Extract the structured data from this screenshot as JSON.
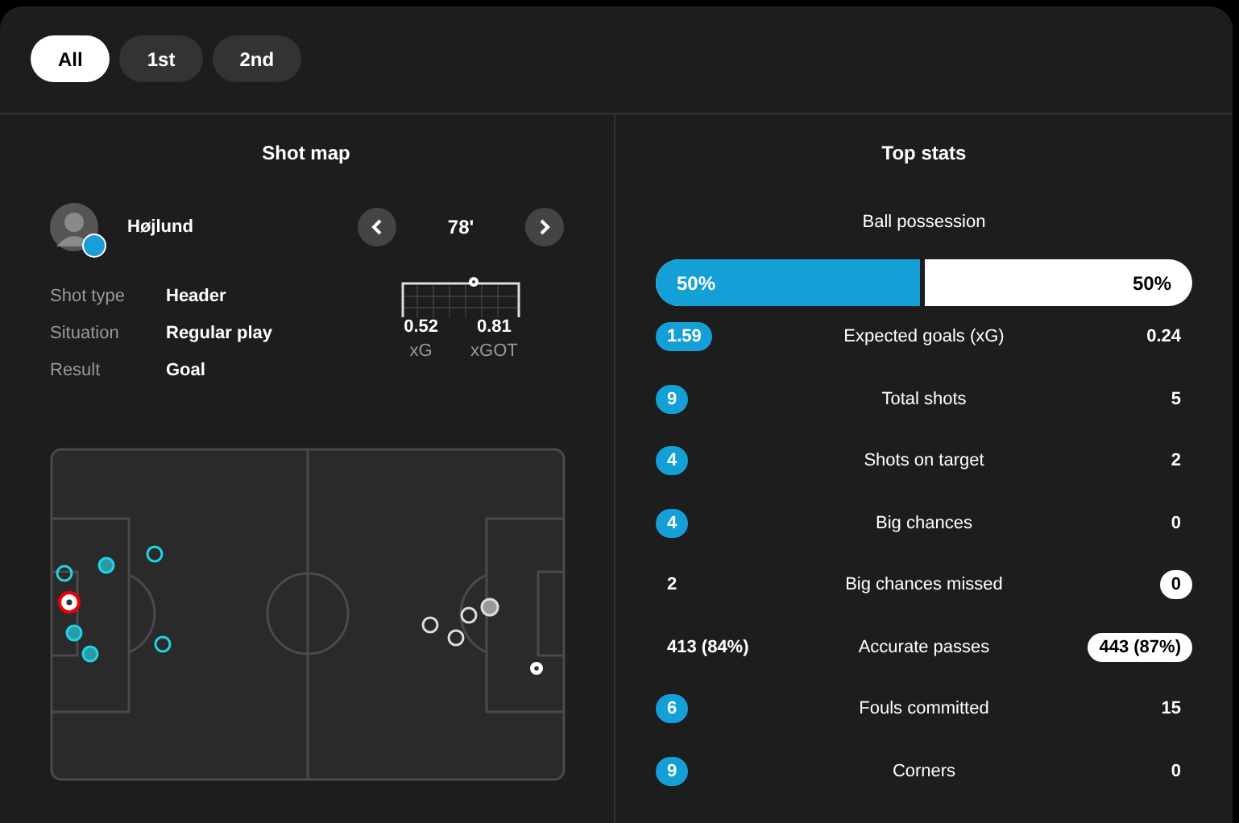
{
  "period_tabs": [
    {
      "label": "All",
      "selected": true
    },
    {
      "label": "1st",
      "selected": false
    },
    {
      "label": "2nd",
      "selected": false
    }
  ],
  "shot_map": {
    "title": "Shot map",
    "player": "Højlund",
    "minute": "78'",
    "details": [
      {
        "label": "Shot type",
        "value": "Header"
      },
      {
        "label": "Situation",
        "value": "Regular play"
      },
      {
        "label": "Result",
        "value": "Goal"
      }
    ],
    "xg": "0.52",
    "xg_label": "xG",
    "xgot": "0.81",
    "xgot_label": "xGOT"
  },
  "top_stats": {
    "title": "Top stats",
    "possession": {
      "label": "Ball possession",
      "home": "50%",
      "away": "50%",
      "level": 0.5
    },
    "rows": [
      {
        "label": "Expected goals (xG)",
        "home": "1.59",
        "away": "0.24",
        "home_highlighted": true,
        "away_highlighted": false
      },
      {
        "label": "Total shots",
        "home": "9",
        "away": "5",
        "home_highlighted": true,
        "away_highlighted": false
      },
      {
        "label": "Shots on target",
        "home": "4",
        "away": "2",
        "home_highlighted": true,
        "away_highlighted": false
      },
      {
        "label": "Big chances",
        "home": "4",
        "away": "0",
        "home_highlighted": true,
        "away_highlighted": false
      },
      {
        "label": "Big chances missed",
        "home": "2",
        "away": "0",
        "home_highlighted": false,
        "away_highlighted": true
      },
      {
        "label": "Accurate passes",
        "home": "413 (84%)",
        "away": "443 (87%)",
        "home_highlighted": false,
        "away_highlighted": true
      },
      {
        "label": "Fouls committed",
        "home": "6",
        "away": "15",
        "home_highlighted": true,
        "away_highlighted": false
      },
      {
        "label": "Corners",
        "home": "9",
        "away": "0",
        "home_highlighted": true,
        "away_highlighted": false
      }
    ]
  }
}
